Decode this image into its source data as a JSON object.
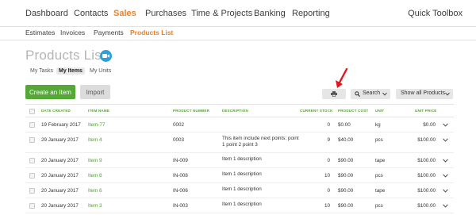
{
  "topnav": {
    "items": [
      "Dashboard",
      "Contacts",
      "Sales",
      "Purchases",
      "Time & Projects",
      "Banking",
      "Reporting"
    ],
    "active": "Sales",
    "toolbox": "Quick Toolbox"
  },
  "subnav": {
    "items": [
      "Estimates",
      "Invoices",
      "Payments",
      "Products List"
    ],
    "active": "Products List"
  },
  "page": {
    "title": "Products List",
    "video_icon": "video-camera-icon"
  },
  "tabs": {
    "items": [
      "My Tasks",
      "My Items",
      "My Units"
    ],
    "active": "My Items"
  },
  "toolbar": {
    "add_label": "Create an Item",
    "import_label": "Import",
    "print_icon": "printer-icon",
    "search_label": "Search",
    "show_label": "Show all Products"
  },
  "colors": {
    "accent": "#e8802b",
    "green": "#55a836",
    "link": "#4f9f2f",
    "arrow": "#e3161b",
    "video": "#2e9fd8"
  },
  "table": {
    "headers": [
      "DATE CREATED",
      "ITEM NAME",
      "PRODUCT NUMBER",
      "DESCRIPTION",
      "CURRENT STOCK",
      "PRODUCT COST",
      "UNIT",
      "UNIT PRICE"
    ],
    "rows": [
      {
        "date": "19 February 2017",
        "name": "Item-77",
        "number": "0002",
        "description": "",
        "stock": "0",
        "cost": "$0.00",
        "unit": "kg",
        "price": "$0.00"
      },
      {
        "date": "29 January 2017",
        "name": "Item 4",
        "number": "0003",
        "description": "This item include next points: point 1 point 2 point 3",
        "stock": "9",
        "cost": "$40.00",
        "unit": "pcs",
        "price": "$100.00"
      },
      {
        "date": "20 January 2017",
        "name": "Item 9",
        "number": "IN-009",
        "description": "Item 1 description",
        "stock": "0",
        "cost": "$90.00",
        "unit": "tape",
        "price": "$100.00"
      },
      {
        "date": "20 January 2017",
        "name": "Item 8",
        "number": "IN-008",
        "description": "Item 1 description",
        "stock": "10",
        "cost": "$90.00",
        "unit": "pcs",
        "price": "$100.00"
      },
      {
        "date": "20 January 2017",
        "name": "Item 6",
        "number": "IN-006",
        "description": "Item 1 description",
        "stock": "0",
        "cost": "$90.00",
        "unit": "tape",
        "price": "$100.00"
      },
      {
        "date": "20 January 2017",
        "name": "Item 3",
        "number": "IN-003",
        "description": "Item 1 description",
        "stock": "10",
        "cost": "$90.00",
        "unit": "pcs",
        "price": "$100.00"
      }
    ]
  }
}
